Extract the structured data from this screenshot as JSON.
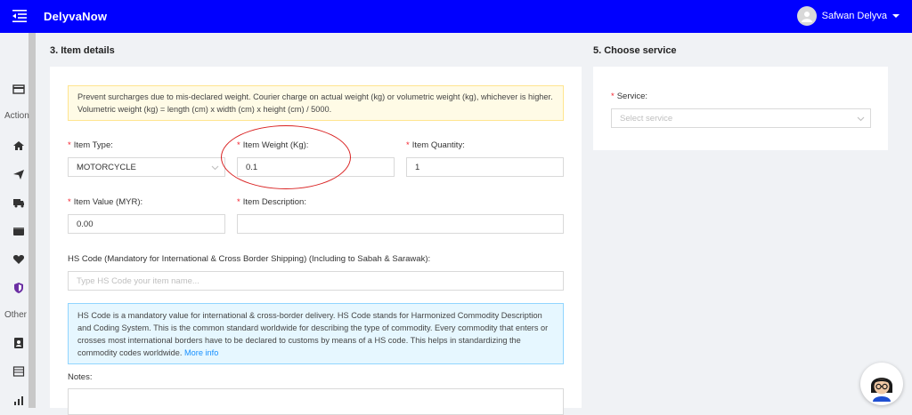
{
  "header": {
    "brand": "DelyvaNow",
    "user_name": "Safwan Delyva"
  },
  "sidebar": {
    "section_action": "Action",
    "section_other": "Other"
  },
  "item_details": {
    "title": "3. Item details",
    "notice": "Prevent surcharges due to mis-declared weight. Courier charge on actual weight (kg) or volumetric weight (kg), whichever is higher. Volumetric weight (kg) = length (cm) x width (cm) x height (cm) / 5000.",
    "item_type_label": "Item Type:",
    "item_type_value": "MOTORCYCLE",
    "item_weight_label": "Item Weight (Kg):",
    "item_weight_value": "0.1",
    "item_quantity_label": "Item Quantity:",
    "item_quantity_value": "1",
    "item_value_label": "Item Value (MYR):",
    "item_value_value": "0.00",
    "item_description_label": "Item Description:",
    "item_description_value": "",
    "hs_code_label": "HS Code (Mandatory for International & Cross Border Shipping) (Including to Sabah & Sarawak):",
    "hs_code_placeholder": "Type HS Code your item name...",
    "hs_info": "HS Code is a mandatory value for international & cross-border delivery. HS Code stands for Harmonized Commodity Description and Coding System. This is the common standard worldwide for describing the type of commodity. Every commodity that enters or crosses most international borders have to be declared to customs by means of a HS code. This helps in standardizing the commodity codes worldwide.",
    "more_info_link": "More info",
    "notes_label": "Notes:"
  },
  "choose_service": {
    "title": "5. Choose service",
    "service_label": "Service:",
    "service_placeholder": "Select service"
  },
  "colors": {
    "topbar": "#0000ff",
    "required": "#f5222d",
    "annotation": "#d92020"
  }
}
